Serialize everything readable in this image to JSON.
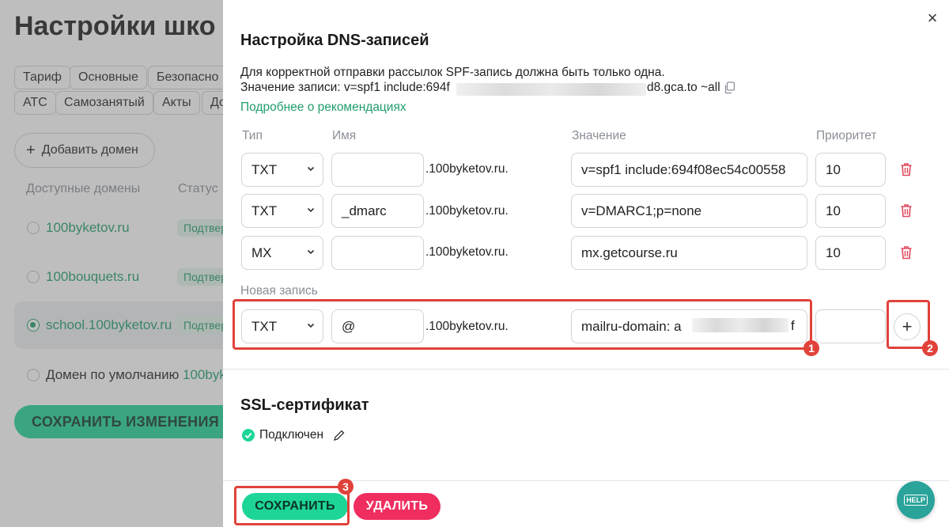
{
  "background": {
    "title": "Настройки шко",
    "tabs_row1": [
      "Тариф",
      "Основные",
      "Безопасно"
    ],
    "tabs_row2": [
      "АТС",
      "Самозанятый",
      "Акты",
      "До"
    ],
    "add_domain_label": "Добавить домен",
    "columns": {
      "domains": "Доступные домены",
      "status": "Статус"
    },
    "domains": [
      {
        "name": "100byketov.ru",
        "status": "Подтвер",
        "selected": false
      },
      {
        "name": "100bouquets.ru",
        "status": "Подтвер",
        "selected": false
      },
      {
        "name": "school.100byketov.ru",
        "status": "Подтвер",
        "selected": true
      }
    ],
    "default_domain_label": "Домен по умолчанию",
    "default_domain_value": "100byk",
    "save_changes_label": "СОХРАНИТЬ ИЗМЕНЕНИЯ"
  },
  "modal": {
    "close_icon": "×",
    "dns_title": "Настройка DNS-записей",
    "description_line1": "Для корректной отправки рассылок SPF-запись должна быть только одна.",
    "description_line2_start": "Значение записи: v=spf1 include:694f",
    "description_line2_end": "d8.gca.to ~all",
    "more_link": "Подробнее о рекомендациях",
    "table_headers": {
      "type": "Тип",
      "name": "Имя",
      "value": "Значение",
      "priority": "Приоритет"
    },
    "records": [
      {
        "type": "TXT",
        "name": "",
        "suffix": ".100byketov.ru.",
        "value": "v=spf1 include:694f08ec54c00558",
        "priority": "10"
      },
      {
        "type": "TXT",
        "name": "_dmarc",
        "suffix": ".100byketov.ru.",
        "value": "v=DMARC1;p=none",
        "priority": "10"
      },
      {
        "type": "MX",
        "name": "",
        "suffix": ".100byketov.ru.",
        "value": "mx.getcourse.ru",
        "priority": "10"
      }
    ],
    "new_record": {
      "label": "Новая запись",
      "type": "TXT",
      "name": "@",
      "suffix": ".100byketov.ru.",
      "value_start": "mailru-domain: a",
      "value_end": "f",
      "priority": ""
    },
    "plus_label": "+",
    "ssl_title": "SSL-сертификат",
    "ssl_status": "Подключен",
    "save_label": "СОХРАНИТЬ",
    "delete_label": "УДАЛИТЬ"
  },
  "annotations": [
    "1",
    "2",
    "3"
  ],
  "help_widget_label": "HELP",
  "colors": {
    "accent_green": "#1ed598",
    "link_green": "#1e9e69",
    "delete_red": "#f02d5f",
    "annotation_red": "#e0423a",
    "help_teal": "#2aa39a"
  }
}
